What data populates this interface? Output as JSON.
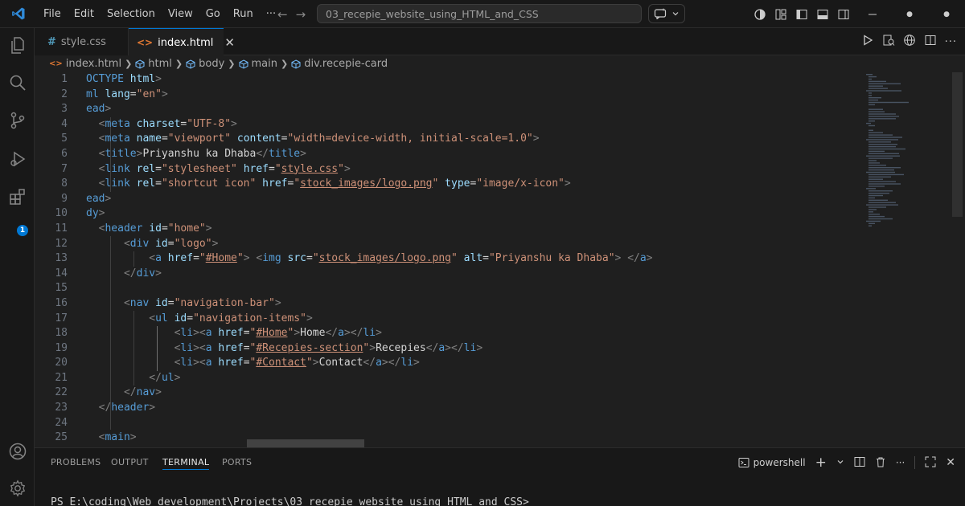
{
  "titlebar": {
    "menu": [
      "File",
      "Edit",
      "Selection",
      "View",
      "Go",
      "Run",
      "···"
    ],
    "command_center": "03_recepie_website_using_HTML_and_CSS"
  },
  "tabs": [
    {
      "label": "style.css",
      "icon": "css-hash-icon",
      "active": false
    },
    {
      "label": "index.html",
      "icon": "html-icon",
      "active": true
    }
  ],
  "breadcrumbs": [
    "index.html",
    "html",
    "body",
    "main",
    "div.recepie-card"
  ],
  "activity_badge": "1",
  "editor": {
    "line_numbers": [
      "1",
      "2",
      "3",
      "4",
      "5",
      "6",
      "7",
      "8",
      "9",
      "10",
      "11",
      "12",
      "13",
      "14",
      "15",
      "16",
      "17",
      "18",
      "19",
      "20",
      "21",
      "22",
      "23",
      "24",
      "25"
    ]
  },
  "panel": {
    "tabs": [
      "PROBLEMS",
      "OUTPUT",
      "TERMINAL",
      "PORTS"
    ],
    "active_tab": "TERMINAL",
    "shell": "powershell",
    "terminal_prompt": "PS E:\\coding\\Web development\\Projects\\03_recepie_website_using_HTML_and_CSS>"
  },
  "colors": {
    "accent": "#0078d4",
    "tag": "#569cd6",
    "attribute": "#9cdcfe",
    "string": "#ce9178"
  }
}
